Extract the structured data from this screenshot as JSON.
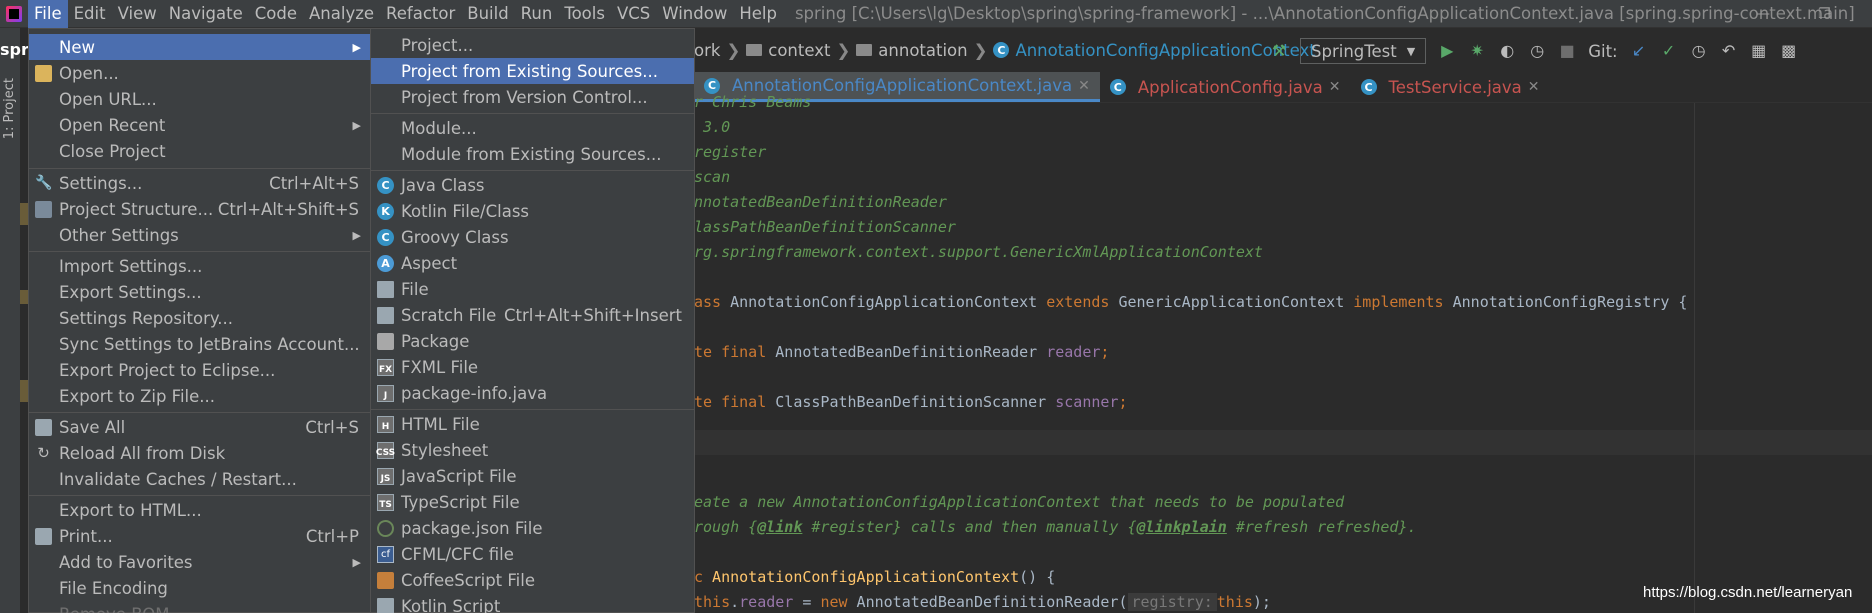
{
  "menubar": {
    "items": [
      "File",
      "Edit",
      "View",
      "Navigate",
      "Code",
      "Analyze",
      "Refactor",
      "Build",
      "Run",
      "Tools",
      "VCS",
      "Window",
      "Help"
    ],
    "active_index": 0,
    "title": "spring [C:\\Users\\lg\\Desktop\\spring\\spring-framework] - ...\\AnnotationConfigApplicationContext.java [spring.spring-context.main]"
  },
  "project_label": "spri",
  "left_tool_window": "1: Project",
  "navbar": {
    "crumbs": [
      "ork",
      "context",
      "annotation"
    ],
    "current_class": "AnnotationConfigApplicationContext"
  },
  "toolbar": {
    "run_config": "SpringTest",
    "git_label": "Git:"
  },
  "tabs": [
    {
      "name": "AnnotationConfigApplicationContext.java",
      "active": true,
      "color": "blue"
    },
    {
      "name": "ApplicationConfig.java",
      "active": false,
      "color": "red"
    },
    {
      "name": "TestService.java",
      "active": false,
      "color": "red"
    }
  ],
  "file_menu": {
    "items": [
      {
        "label": "New",
        "selected": true,
        "submenu": true
      },
      {
        "label": "Open...",
        "icon": "folder-icon"
      },
      {
        "label": "Open URL..."
      },
      {
        "label": "Open Recent",
        "submenu": true
      },
      {
        "label": "Close Project"
      },
      {
        "separator": true
      },
      {
        "label": "Settings...",
        "shortcut": "Ctrl+Alt+S",
        "icon": "wrench-icon"
      },
      {
        "label": "Project Structure...",
        "shortcut": "Ctrl+Alt+Shift+S",
        "icon": "project-structure-icon"
      },
      {
        "label": "Other Settings",
        "submenu": true
      },
      {
        "separator": true
      },
      {
        "label": "Import Settings..."
      },
      {
        "label": "Export Settings..."
      },
      {
        "label": "Settings Repository..."
      },
      {
        "label": "Sync Settings to JetBrains Account..."
      },
      {
        "label": "Export Project to Eclipse..."
      },
      {
        "label": "Export to Zip File..."
      },
      {
        "separator": true
      },
      {
        "label": "Save All",
        "shortcut": "Ctrl+S",
        "icon": "save-icon"
      },
      {
        "label": "Reload All from Disk",
        "icon": "reload-icon"
      },
      {
        "label": "Invalidate Caches / Restart..."
      },
      {
        "separator": true
      },
      {
        "label": "Export to HTML..."
      },
      {
        "label": "Print...",
        "shortcut": "Ctrl+P",
        "icon": "printer-icon"
      },
      {
        "label": "Add to Favorites",
        "submenu": true
      },
      {
        "label": "File Encoding"
      },
      {
        "label": "Remove BOM",
        "disabled": true
      }
    ]
  },
  "new_menu": {
    "items": [
      {
        "label": "Project..."
      },
      {
        "label": "Project from Existing Sources...",
        "selected": true
      },
      {
        "label": "Project from Version Control..."
      },
      {
        "separator": true
      },
      {
        "label": "Module..."
      },
      {
        "label": "Module from Existing Sources..."
      },
      {
        "separator": true
      },
      {
        "label": "Java Class",
        "icon": "java-class-icon"
      },
      {
        "label": "Kotlin File/Class",
        "icon": "kotlin-icon"
      },
      {
        "label": "Groovy Class",
        "icon": "groovy-class-icon"
      },
      {
        "label": "Aspect",
        "icon": "aspect-icon"
      },
      {
        "label": "File",
        "icon": "file-icon"
      },
      {
        "label": "Scratch File",
        "shortcut": "Ctrl+Alt+Shift+Insert",
        "icon": "scratch-file-icon"
      },
      {
        "label": "Package",
        "icon": "package-icon"
      },
      {
        "label": "FXML File",
        "icon": "fxml-icon"
      },
      {
        "label": "package-info.java",
        "icon": "package-info-icon"
      },
      {
        "separator": true
      },
      {
        "label": "HTML File",
        "icon": "html-icon"
      },
      {
        "label": "Stylesheet",
        "icon": "css-icon"
      },
      {
        "label": "JavaScript File",
        "icon": "js-icon"
      },
      {
        "label": "TypeScript File",
        "icon": "ts-icon"
      },
      {
        "label": "package.json File",
        "icon": "json-icon"
      },
      {
        "label": "CFML/CFC file",
        "icon": "cfml-icon"
      },
      {
        "label": "CoffeeScript File",
        "icon": "coffee-icon"
      },
      {
        "label": "Kotlin Script",
        "icon": "kotlin-script-icon"
      }
    ]
  },
  "code": {
    "l1": "r Chris Beams",
    "l2": " 3.0",
    "l3": "register",
    "l4": "scan",
    "l5": "nnotatedBeanDefinitionReader",
    "l6": "lassPathBeanDefinitionScanner",
    "l7": "rg.springframework.context.support.GenericXmlApplicationContext",
    "l8_kw1": "ass",
    "l8_a": " AnnotationConfigApplicationContext ",
    "l8_kw2": "extends",
    "l8_b": " GenericApplicationContext ",
    "l8_kw3": "implements",
    "l8_c": " AnnotationConfigRegistry {",
    "l9_kw": "te final",
    "l9_t": " AnnotatedBeanDefinitionReader ",
    "l9_f": "reader",
    "l9_e": ";",
    "l10_kw": "te final",
    "l10_t": " ClassPathBeanDefinitionScanner ",
    "l10_f": "scanner",
    "l10_e": ";",
    "l11": "eate a new AnnotationConfigApplicationContext that needs to be populated",
    "l12_a": "rough {",
    "l12_tag1": "@link",
    "l12_b": " #register} calls and then manually {",
    "l12_tag2": "@linkplain",
    "l12_c": " #refresh refreshed}.",
    "l13_kw": "c",
    "l13_fn": " AnnotationConfigApplicationContext",
    "l13_e": "() {",
    "l14_kw1": "this",
    "l14_a": ".",
    "l14_f": "reader",
    "l14_b": " = ",
    "l14_kw2": "new",
    "l14_c": " AnnotatedBeanDefinitionReader(",
    "l14_hint": "registry:",
    "l14_kw3": "this",
    "l14_e": ");"
  },
  "watermark": "https://blog.csdn.net/learneryan"
}
